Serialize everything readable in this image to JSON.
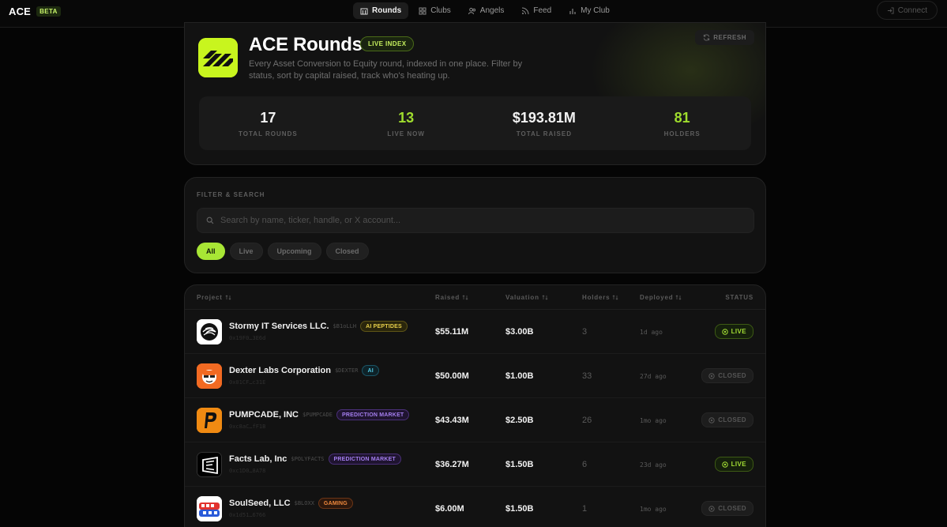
{
  "brand": {
    "name": "ACE",
    "badge": "BETA"
  },
  "nav": [
    {
      "label": "Rounds",
      "icon": "building-icon",
      "active": true
    },
    {
      "label": "Clubs",
      "icon": "grid-icon",
      "active": false
    },
    {
      "label": "Angels",
      "icon": "users-icon",
      "active": false
    },
    {
      "label": "Feed",
      "icon": "rss-icon",
      "active": false
    },
    {
      "label": "My Club",
      "icon": "bar-chart-icon",
      "active": false
    }
  ],
  "connect_label": "Connect",
  "hero": {
    "title": "ACE Rounds",
    "badge": "LIVE INDEX",
    "description": "Every Asset Conversion to Equity round, indexed in one place. Filter by status, sort by capital raised, track who's heating up.",
    "refresh_label": "REFRESH",
    "stats": [
      {
        "value": "17",
        "label": "TOTAL ROUNDS",
        "color": "#f2f2f2"
      },
      {
        "value": "13",
        "label": "LIVE NOW",
        "color": "#9fdc2d"
      },
      {
        "value": "$193.81M",
        "label": "TOTAL RAISED",
        "color": "#f2f2f2"
      },
      {
        "value": "81",
        "label": "HOLDERS",
        "color": "#9fdc2d"
      }
    ]
  },
  "filter": {
    "title": "FILTER & SEARCH",
    "search_placeholder": "Search by name, ticker, handle, or X account...",
    "search_value": "",
    "chips": [
      {
        "label": "All",
        "active": true
      },
      {
        "label": "Live",
        "active": false
      },
      {
        "label": "Upcoming",
        "active": false
      },
      {
        "label": "Closed",
        "active": false
      }
    ]
  },
  "table": {
    "columns": {
      "project": "Project",
      "raised": "Raised",
      "valuation": "Valuation",
      "holders": "Holders",
      "deployed": "Deployed",
      "status": "STATUS"
    },
    "rows": [
      {
        "name": "Stormy IT Services LLC.",
        "ticker": "$B1oLLH",
        "tag": "AI PEPTIDES",
        "tag_style": "yellow",
        "address": "0x19F0…3E6d",
        "raised": "$55.11M",
        "valuation": "$3.00B",
        "holders": "3",
        "deployed": "1d ago",
        "status": "LIVE",
        "avatar": "stormy"
      },
      {
        "name": "Dexter Labs Corporation",
        "ticker": "$DEXTER",
        "tag": "AI",
        "tag_style": "cyan",
        "address": "0x01CF…c31E",
        "raised": "$50.00M",
        "valuation": "$1.00B",
        "holders": "33",
        "deployed": "27d ago",
        "status": "CLOSED",
        "avatar": "dexter"
      },
      {
        "name": "PUMPCADE, INC",
        "ticker": "$PUMPCADE",
        "tag": "PREDICTION MARKET",
        "tag_style": "purple",
        "address": "0xc8aC…fF1B",
        "raised": "$43.43M",
        "valuation": "$2.50B",
        "holders": "26",
        "deployed": "1mo ago",
        "status": "CLOSED",
        "avatar": "pumpcade"
      },
      {
        "name": "Facts Lab, Inc",
        "ticker": "$POLYFACTS",
        "tag": "PREDICTION MARKET",
        "tag_style": "purple",
        "address": "0xc1D0…8A78",
        "raised": "$36.27M",
        "valuation": "$1.50B",
        "holders": "6",
        "deployed": "23d ago",
        "status": "LIVE",
        "avatar": "facts"
      },
      {
        "name": "SoulSeed, LLC",
        "ticker": "$BLOXX",
        "tag": "GAMING",
        "tag_style": "orange",
        "address": "0x1d51…6766",
        "raised": "$6.00M",
        "valuation": "$1.50B",
        "holders": "1",
        "deployed": "1mo ago",
        "status": "CLOSED",
        "avatar": "soulseed"
      }
    ]
  }
}
